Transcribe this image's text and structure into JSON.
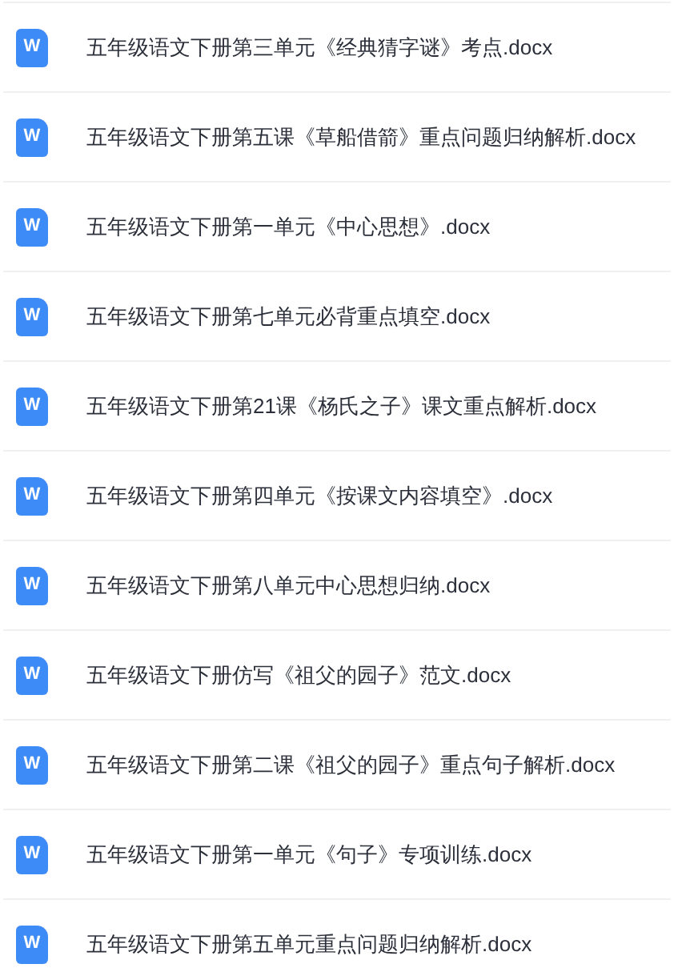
{
  "files": [
    {
      "icon": "W",
      "name": "五年级语文下册第三单元《经典猜字谜》考点.docx"
    },
    {
      "icon": "W",
      "name": "五年级语文下册第五课《草船借箭》重点问题归纳解析.docx"
    },
    {
      "icon": "W",
      "name": "五年级语文下册第一单元《中心思想》.docx"
    },
    {
      "icon": "W",
      "name": "五年级语文下册第七单元必背重点填空.docx"
    },
    {
      "icon": "W",
      "name": "五年级语文下册第21课《杨氏之子》课文重点解析.docx"
    },
    {
      "icon": "W",
      "name": "五年级语文下册第四单元《按课文内容填空》.docx"
    },
    {
      "icon": "W",
      "name": "五年级语文下册第八单元中心思想归纳.docx"
    },
    {
      "icon": "W",
      "name": "五年级语文下册仿写《祖父的园子》范文.docx"
    },
    {
      "icon": "W",
      "name": "五年级语文下册第二课《祖父的园子》重点句子解析.docx"
    },
    {
      "icon": "W",
      "name": "五年级语文下册第一单元《句子》专项训练.docx"
    },
    {
      "icon": "W",
      "name": "五年级语文下册第五单元重点问题归纳解析.docx"
    }
  ]
}
